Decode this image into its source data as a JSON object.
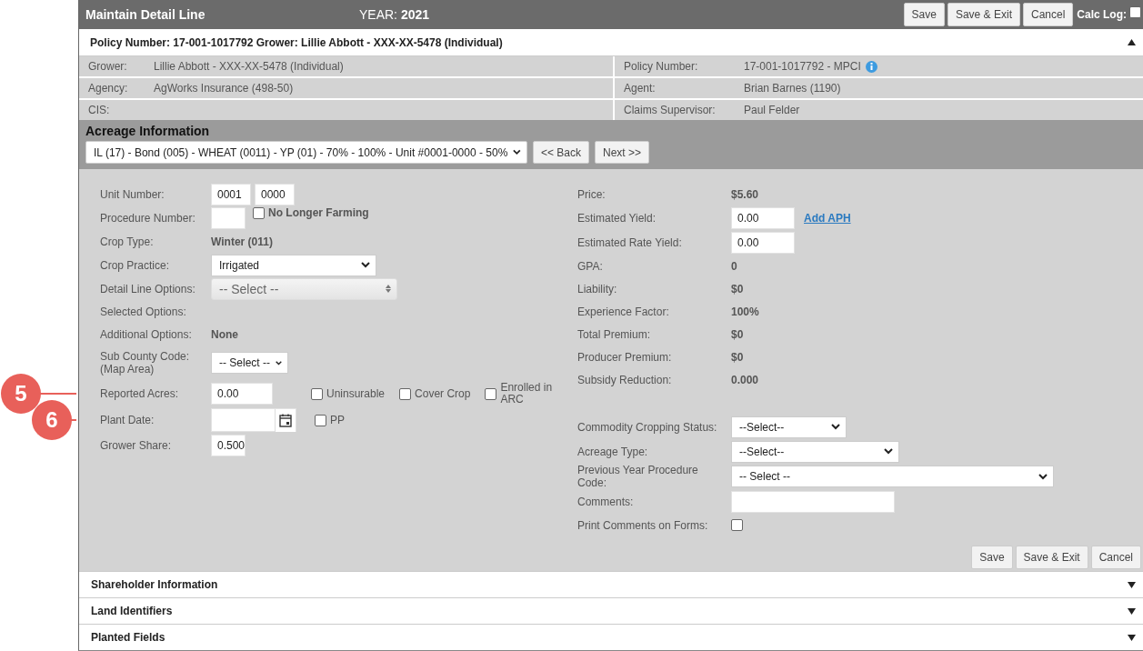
{
  "header": {
    "title": "Maintain Detail Line",
    "year_label": "YEAR:",
    "year": "2021",
    "buttons": [
      "Save",
      "Save & Exit",
      "Cancel"
    ],
    "calc_log": {
      "label": "Calc Log:",
      "checked": false
    }
  },
  "policy_panel": {
    "title": "Policy Number: 17-001-1017792 Grower: Lillie Abbott - XXX-XX-5478 (Individual)",
    "expanded": true,
    "rows": [
      [
        {
          "label": "Grower:",
          "value": "Lillie Abbott - XXX-XX-5478 (Individual)"
        },
        {
          "label": "Policy Number:",
          "value": "17-001-1017792 - MPCI",
          "info": true
        }
      ],
      [
        {
          "label": "Agency:",
          "value": "AgWorks Insurance (498-50)"
        },
        {
          "label": "Agent:",
          "value": "Brian Barnes (1190)"
        }
      ],
      [
        {
          "label": "CIS:"
        },
        {
          "label": "Claims Supervisor:",
          "value": "Paul Felder"
        }
      ]
    ]
  },
  "acreage": {
    "title": "Acreage Information",
    "unit_select": "IL (17) - Bond (005) - WHEAT (0011) - YP (01) - 70% - 100% - Unit #0001-0000 - 50%",
    "nav_buttons": [
      "<< Back",
      "Next >>"
    ]
  },
  "left_fields": [
    {
      "kind": "inputs",
      "label": "Unit Number:",
      "values": [
        "0001",
        "0000"
      ]
    },
    {
      "kind": "input",
      "label": "Procedure Number:",
      "checks": [
        {
          "label": "No Longer Farming",
          "checked": false
        }
      ]
    },
    {
      "kind": "text",
      "label": "Crop Type:",
      "value": "Winter (011)"
    },
    {
      "kind": "select",
      "label": "Crop Practice:",
      "value": "Irrigated"
    },
    {
      "kind": "picker",
      "label": "Detail Line Options:",
      "value": "-- Select --"
    },
    {
      "kind": "text",
      "label": "Selected Options:"
    },
    {
      "kind": "text",
      "label": "Additional Options:",
      "value": "None"
    },
    {
      "kind": "select",
      "label": "Sub County Code:",
      "sublabel": "(Map Area)",
      "value": "-- Select --"
    },
    {
      "kind": "input",
      "label": "Reported Acres:",
      "value": "0.00",
      "callout": "5",
      "checks": [
        {
          "label": "Uninsurable",
          "checked": false
        },
        {
          "label": "Cover Crop",
          "checked": false
        },
        {
          "label": "Enrolled in ARC",
          "checked": false
        }
      ]
    },
    {
      "kind": "date",
      "label": "Plant Date:",
      "callout": "6",
      "checks": [
        {
          "label": "PP",
          "checked": false
        }
      ]
    },
    {
      "kind": "input",
      "label": "Grower Share:",
      "value": "0.500"
    }
  ],
  "summary_fields": [
    {
      "kind": "text",
      "label": "Price:",
      "value": "$5.60"
    },
    {
      "kind": "input",
      "label": "Estimated Yield:",
      "value": "0.00",
      "link": "Add APH"
    },
    {
      "kind": "input",
      "label": "Estimated Rate Yield:",
      "value": "0.00"
    },
    {
      "kind": "text",
      "label": "GPA:",
      "value": "0"
    },
    {
      "kind": "text",
      "label": "Liability:",
      "value": "$0"
    },
    {
      "kind": "text",
      "label": "Experience Factor:",
      "value": "100%"
    },
    {
      "kind": "text",
      "label": "Total Premium:",
      "value": "$0"
    },
    {
      "kind": "text",
      "label": "Producer Premium:",
      "value": "$0"
    },
    {
      "kind": "text",
      "label": "Subsidy Reduction:",
      "value": "0.000"
    }
  ],
  "status_fields": [
    {
      "kind": "select",
      "label": "Commodity Cropping Status:",
      "value": "--Select--"
    },
    {
      "kind": "select",
      "label": "Acreage Type:",
      "value": "--Select--"
    },
    {
      "kind": "select",
      "label": "Previous Year Procedure Code:",
      "value": "-- Select --"
    },
    {
      "kind": "input",
      "label": "Comments:"
    },
    {
      "kind": "checkbox",
      "label": "Print Comments on Forms:",
      "checked": false
    }
  ],
  "form_buttons": [
    "Save",
    "Save & Exit",
    "Cancel"
  ],
  "sections": [
    {
      "title": "Shareholder Information",
      "expanded": false
    },
    {
      "title": "Land Identifiers",
      "expanded": false
    },
    {
      "title": "Planted Fields",
      "expanded": false
    }
  ]
}
